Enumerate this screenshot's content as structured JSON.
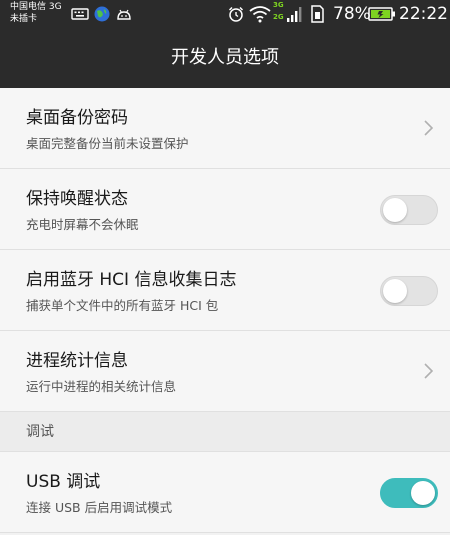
{
  "status_bar": {
    "carrier_line1": "中国电信 3G",
    "carrier_line2": "未插卡",
    "battery_percent": "78%",
    "time": "22:22",
    "network_3g": "3G",
    "network_2g": "2G",
    "icons": [
      "keyboard-icon",
      "browser-globe-icon",
      "android-icon",
      "alarm-icon",
      "wifi-icon",
      "signal-icon",
      "sim-icon",
      "battery-icon"
    ]
  },
  "header": {
    "title": "开发人员选项"
  },
  "settings": {
    "items": [
      {
        "title": "桌面备份密码",
        "subtitle": "桌面完整备份当前未设置保护",
        "control": "chevron"
      },
      {
        "title": "保持唤醒状态",
        "subtitle": "充电时屏幕不会休眠",
        "control": "toggle",
        "on": false
      },
      {
        "title": "启用蓝牙 HCI 信息收集日志",
        "subtitle": "捕获单个文件中的所有蓝牙 HCI 包",
        "control": "toggle",
        "on": false
      },
      {
        "title": "进程统计信息",
        "subtitle": "运行中进程的相关统计信息",
        "control": "chevron"
      }
    ]
  },
  "debug_section": {
    "label": "调试",
    "items": [
      {
        "title": "USB 调试",
        "subtitle": "连接 USB 后启用调试模式",
        "control": "toggle",
        "on": true
      }
    ]
  },
  "colors": {
    "bar_background": "#2b2b2b",
    "toggle_on": "#3ebcbc",
    "toggle_off": "#e3e3e3",
    "list_background": "#f6f6f6",
    "battery_fill": "#7ed321"
  }
}
